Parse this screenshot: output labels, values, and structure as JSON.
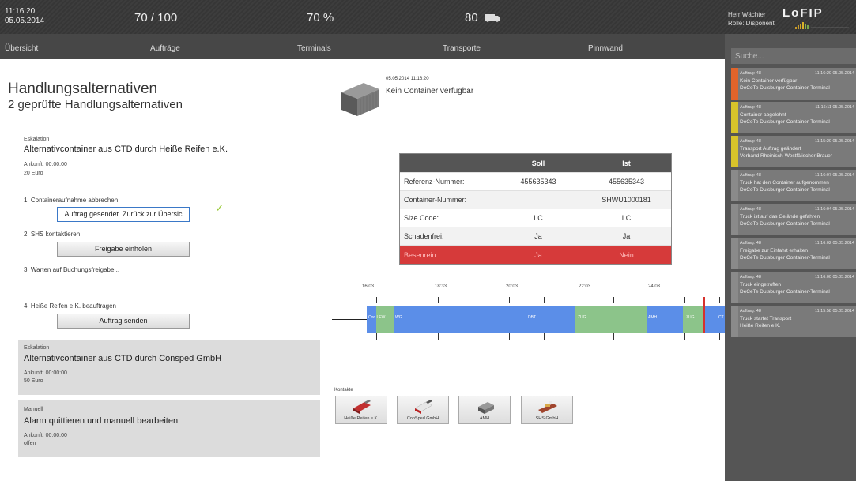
{
  "header": {
    "time": "11:16:20",
    "date": "05.05.2014",
    "stat1": "70 / 100",
    "stat2": "70 %",
    "stat3": "80",
    "user_line1": "Herr Wächter",
    "user_line2": "Rolle: Disponent",
    "logo": "LoFIP"
  },
  "nav": [
    "Übersicht",
    "Aufträge",
    "Terminals",
    "Transporte",
    "Pinnwand"
  ],
  "sidebar": {
    "search_placeholder": "Suche...",
    "messages": [
      {
        "order": "Auftrag: 48",
        "ts": "11:16:20 05.05.2014",
        "line1": "Kein Container verfügbar",
        "line2": "DeCeTe Duisburger Container-Terminal",
        "color": "#e0642b"
      },
      {
        "order": "Auftrag: 48",
        "ts": "11:16:11 05.05.2014",
        "line1": "Container abgelehnt",
        "line2": "DeCeTe Duisburger Container-Terminal",
        "color": "#d8c32a"
      },
      {
        "order": "Auftrag: 48",
        "ts": "11:15:20 05.05.2014",
        "line1": "Transport Auftrag geändert",
        "line2": "Verband Rheinisch-Westfälischer Brauer",
        "color": "#d8c32a"
      },
      {
        "order": "Auftrag: 48",
        "ts": "11:16:07 05.05.2014",
        "line1": "Truck hat den Container aufgenommen",
        "line2": "DeCeTe Duisburger Container-Terminal",
        "color": "#8a8a8a"
      },
      {
        "order": "Auftrag: 48",
        "ts": "11:16:04 05.05.2014",
        "line1": "Truck ist auf das Gelände gefahren",
        "line2": "DeCeTe Duisburger Container-Terminal",
        "color": "#8a8a8a"
      },
      {
        "order": "Auftrag: 48",
        "ts": "11:16:02 05.05.2014",
        "line1": "Freigabe zur Einfahrt erhalten",
        "line2": "DeCeTe Duisburger Container-Terminal",
        "color": "#8a8a8a"
      },
      {
        "order": "Auftrag: 48",
        "ts": "11:16:00 05.05.2014",
        "line1": "Truck eingetroffen",
        "line2": "DeCeTe Duisburger Container-Terminal",
        "color": "#8a8a8a"
      },
      {
        "order": "Auftrag: 48",
        "ts": "11:15:58 05.05.2014",
        "line1": "Truck startet Transport",
        "line2": "Heiße Reifen e.K.",
        "color": "#8a8a8a"
      }
    ]
  },
  "left": {
    "title": "Handlungsalternativen",
    "subtitle": "2 geprüfte Handlungsalternativen",
    "alt1": {
      "type": "Eskalation",
      "title": "Alternativcontainer aus CTD durch Heiße Reifen e.K.",
      "arrival": "Ankunft: 00:00:00",
      "cost": "20 Euro",
      "step1": "1. Containeraufnahme abbrechen",
      "step1_btn": "Auftrag gesendet. Zurück zur Übersic",
      "step2": "2. SHS kontaktieren",
      "step2_btn": "Freigabe einholen",
      "step3": "3. Warten auf Buchungsfreigabe...",
      "step4": "4. Heiße Reifen e.K. beauftragen",
      "step4_btn": "Auftrag senden"
    },
    "alt2": {
      "type": "Eskalation",
      "title": "Alternativcontainer aus CTD durch Consped GmbH",
      "arrival": "Ankunft: 00:00:00",
      "cost": "50 Euro"
    },
    "alt3": {
      "type": "Manuell",
      "title": "Alarm quittieren und manuell bearbeiten",
      "arrival": "Ankunft: 00:00:00",
      "cost": "offen"
    }
  },
  "event": {
    "timestamp": "05.05.2014 11:16:20",
    "text": "Kein Container verfügbar"
  },
  "table": {
    "headers": [
      "",
      "Soll",
      "Ist"
    ],
    "rows": [
      [
        "Referenz-Nummer:",
        "455635343",
        "455635343"
      ],
      [
        "Container-Nummer:",
        "",
        "SHWU1000181"
      ],
      [
        "Size Code:",
        "LC",
        "LC"
      ],
      [
        "Schadenfrei:",
        "Ja",
        "Ja"
      ],
      [
        "Besenrein:",
        "Ja",
        "Nein"
      ]
    ]
  },
  "timeline": {
    "ticks": [
      "16:03",
      "18:33",
      "20:03",
      "22:03",
      "24:03"
    ],
    "segments": [
      "Con LEW",
      "WG",
      "DBT",
      "ZUG",
      "AMH",
      "ZUG",
      "CT"
    ]
  },
  "contacts": {
    "label": "Kontakte",
    "items": [
      "Heiße Reifen e.K.",
      "ConSped GmbH",
      "AMH",
      "SHS GmbH"
    ]
  },
  "colors": {
    "blue": "#5b8ee8",
    "green": "#8cc48a",
    "red_row": "#d63a3a",
    "sidebar_orange": "#e0642b",
    "sidebar_yellow": "#d8c32a"
  }
}
